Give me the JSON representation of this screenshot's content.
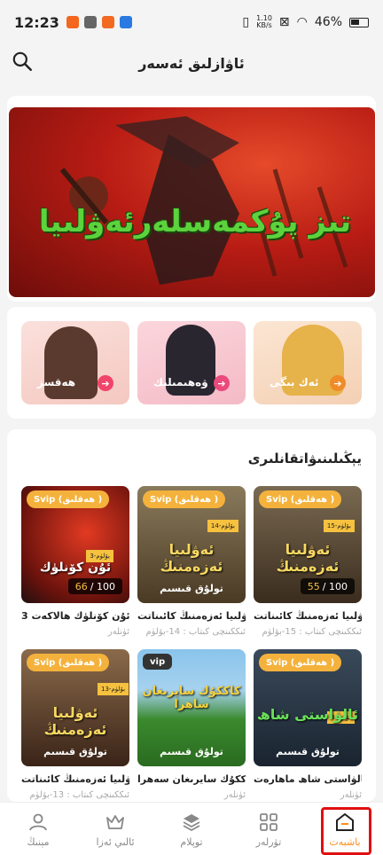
{
  "statusbar": {
    "time": "12:23",
    "network_speed": "1.10\nKB/s",
    "battery": "46%"
  },
  "header": {
    "title": "ئاۋازلىق ئەسەر",
    "search_icon": "search-icon"
  },
  "banner": {
    "title": "تىز پۇكمەسلەرئەۋلىيا"
  },
  "categories": [
    {
      "label": "ئەك بىگى",
      "color": "#f08c28"
    },
    {
      "label": "ۋەھىمىلىك",
      "color": "#ea4a7c"
    },
    {
      "label": "ھەقسز",
      "color": "#f0446a"
    }
  ],
  "section": {
    "title": "يېڭىلىنىۋاتقانلىرى"
  },
  "books": [
    {
      "badge": "Svip (ھەقلىق )",
      "ep": "15-بۆلۈم",
      "cover_text": "ئەۋلىيا ئەزەمنىڭ",
      "progress_current": "55",
      "progress_total": "/ 100",
      "title": "ئەۋلىيا ئەزەمنىڭ كائىناتت...",
      "meta": "ئىككىنچى كىتاب : 15-بۆلۈم"
    },
    {
      "badge": "Svip (ھەقلىق )",
      "ep": "14-بۆلۈم",
      "cover_text": "ئەۋلىيا ئەزەمنىڭ",
      "cover_sub": "تولۇق قىسىم",
      "title": "ئەۋلىيا ئەزەمنىڭ كائىناتت...",
      "meta": "ئىككىنچى كىتاب : 14-بۆلۈم"
    },
    {
      "badge": "Svip (ھەقلىق )",
      "ep": "3-بۆلۈم",
      "cover_text": "ئۇن كۆنلۈك",
      "progress_current": "66",
      "progress_total": "/ 100",
      "title": "ئۇن كۆنلۈك ھالاكەت 3-...",
      "meta": "ئۈنلەر"
    },
    {
      "badge": "Svip (ھەقلىق )",
      "ep": "3-بۆلۈم",
      "cover_text": "ئالۋاستى شاھ",
      "cover_sub": "تولۇق قىسىم",
      "title": "ئالۋاستى شاھ ماھارەت ...",
      "meta": "ئۈنلەر"
    },
    {
      "badge": "vip",
      "cover_text": "كاككۇك سايرىغان ساھرا",
      "cover_sub": "تولۇق قىسىم",
      "title": "كاككۇك سايرىغان سەھرا...",
      "meta": "ئۈنلەر"
    },
    {
      "badge": "Svip (ھەقلىق )",
      "ep": "13-بۆلۈم",
      "cover_text": "ئەۋلىيا ئەزەمنىڭ",
      "cover_sub": "تولۇق قىسىم",
      "title": "ئەۋلىيا ئەزەمنىڭ كائىناتت...",
      "meta": "ئىككىنچى كىتاب : 13-بۆلۈم"
    }
  ],
  "tabs": [
    {
      "label": "باشبەت",
      "icon": "home-icon",
      "active": true
    },
    {
      "label": "تۈرلەر",
      "icon": "grid-icon"
    },
    {
      "label": "توپلام",
      "icon": "layers-icon"
    },
    {
      "label": "ئالىي ئەزا",
      "icon": "crown-icon"
    },
    {
      "label": "مېنىڭ",
      "icon": "user-icon"
    }
  ],
  "colors": {
    "accent": "#ff8d1a",
    "highlight": "#e01010"
  }
}
